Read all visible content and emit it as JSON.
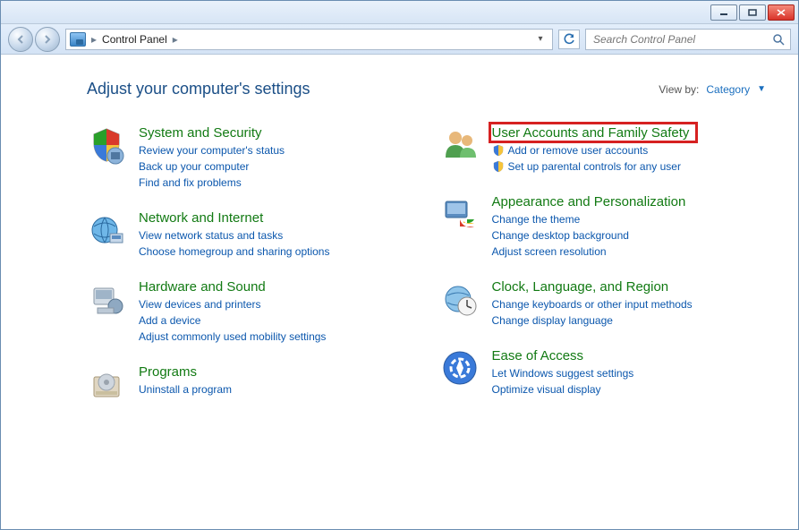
{
  "window": {
    "breadcrumb_root": "Control Panel",
    "search_placeholder": "Search Control Panel"
  },
  "header": {
    "heading": "Adjust your computer's settings",
    "viewby_label": "View by:",
    "viewby_value": "Category"
  },
  "left_categories": [
    {
      "icon": "system-security",
      "title": "System and Security",
      "links": [
        {
          "text": "Review your computer's status"
        },
        {
          "text": "Back up your computer"
        },
        {
          "text": "Find and fix problems"
        }
      ]
    },
    {
      "icon": "network",
      "title": "Network and Internet",
      "links": [
        {
          "text": "View network status and tasks"
        },
        {
          "text": "Choose homegroup and sharing options"
        }
      ]
    },
    {
      "icon": "hardware",
      "title": "Hardware and Sound",
      "links": [
        {
          "text": "View devices and printers"
        },
        {
          "text": "Add a device"
        },
        {
          "text": "Adjust commonly used mobility settings"
        }
      ]
    },
    {
      "icon": "programs",
      "title": "Programs",
      "links": [
        {
          "text": "Uninstall a program"
        }
      ]
    }
  ],
  "right_categories": [
    {
      "icon": "users",
      "title": "User Accounts and Family Safety",
      "highlighted": true,
      "links": [
        {
          "text": "Add or remove user accounts",
          "shield": true
        },
        {
          "text": "Set up parental controls for any user",
          "shield": true
        }
      ]
    },
    {
      "icon": "appearance",
      "title": "Appearance and Personalization",
      "links": [
        {
          "text": "Change the theme"
        },
        {
          "text": "Change desktop background"
        },
        {
          "text": "Adjust screen resolution"
        }
      ]
    },
    {
      "icon": "clock",
      "title": "Clock, Language, and Region",
      "links": [
        {
          "text": "Change keyboards or other input methods"
        },
        {
          "text": "Change display language"
        }
      ]
    },
    {
      "icon": "ease",
      "title": "Ease of Access",
      "links": [
        {
          "text": "Let Windows suggest settings"
        },
        {
          "text": "Optimize visual display"
        }
      ]
    }
  ]
}
